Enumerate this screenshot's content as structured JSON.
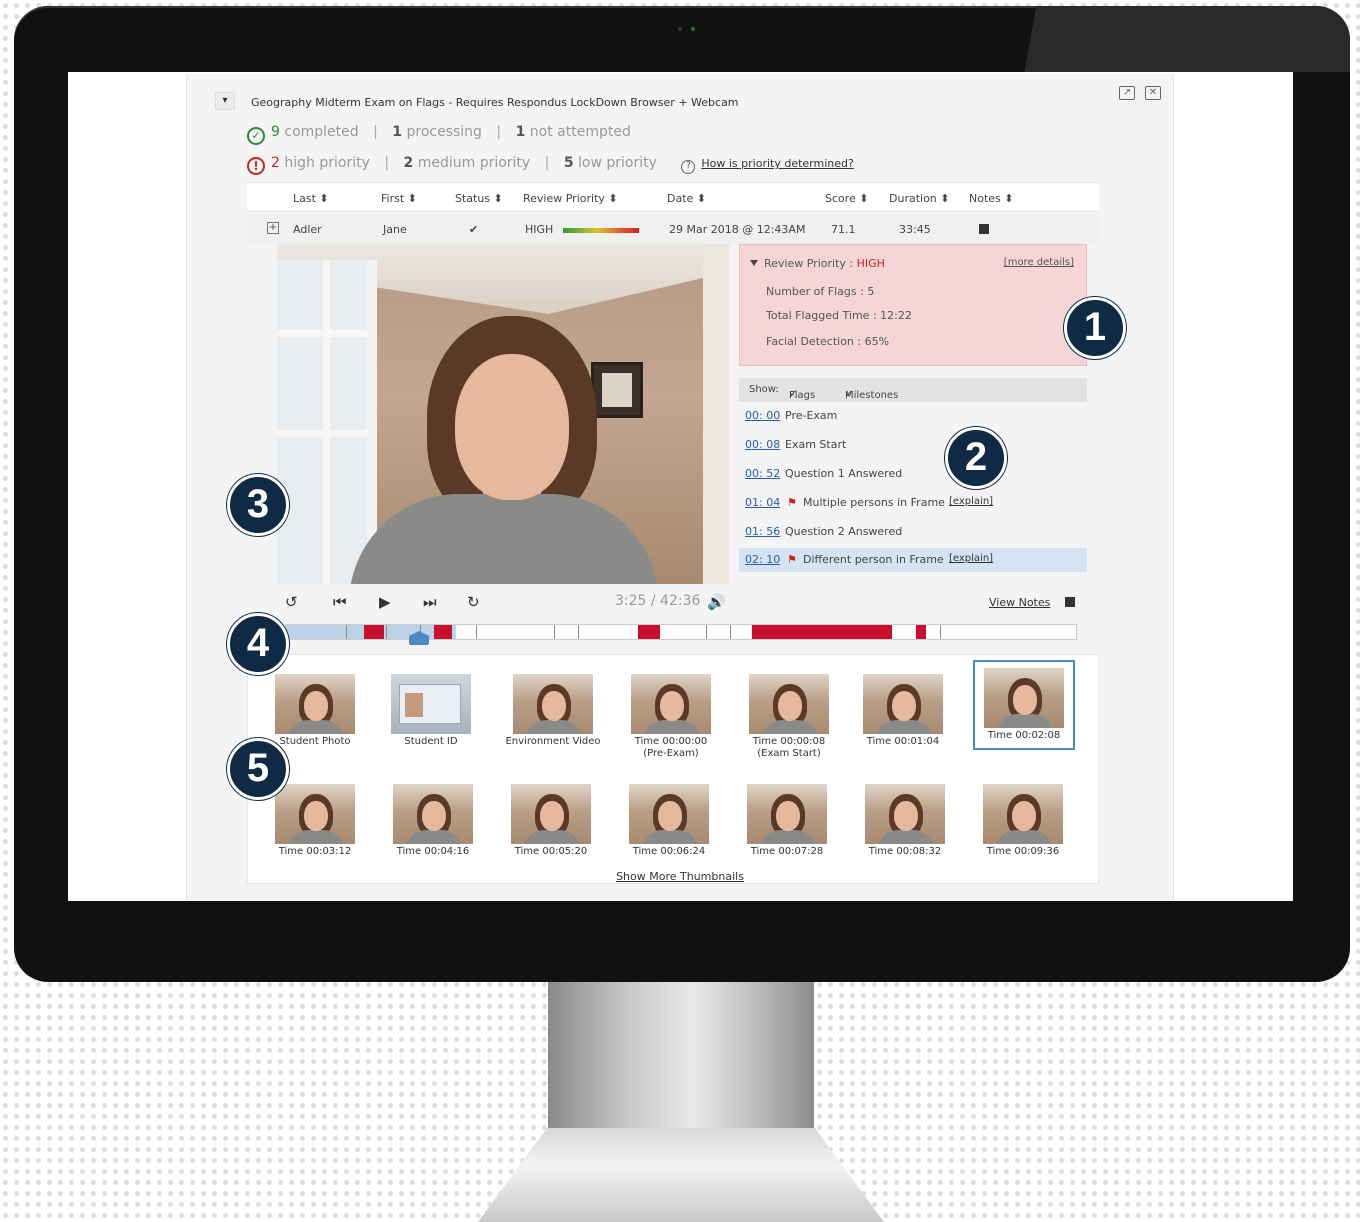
{
  "exam": {
    "title": "Geography Midterm Exam on Flags - Requires Respondus LockDown Browser + Webcam"
  },
  "summary": {
    "completed_count": "9",
    "completed_label": "completed",
    "processing_count": "1",
    "processing_label": "processing",
    "not_attempted_count": "1",
    "not_attempted_label": "not attempted",
    "high_count": "2",
    "high_label": "high priority",
    "medium_count": "2",
    "medium_label": "medium priority",
    "low_count": "5",
    "low_label": "low priority",
    "priority_help_link": "How is priority determined?"
  },
  "table": {
    "columns": [
      "Last ⬍",
      "First ⬍",
      "Status ⬍",
      "Review Priority ⬍",
      "Date ⬍",
      "Score ⬍",
      "Duration ⬍",
      "Notes ⬍"
    ],
    "row": {
      "last": "Adler",
      "first": "Jane",
      "status": "✔",
      "priority": "HIGH",
      "date": "29 Mar 2018 @ 12:43AM",
      "score": "71.1",
      "duration": "33:45"
    }
  },
  "review": {
    "heading": "Review Priority : ",
    "level": "HIGH",
    "more_details": "[more details]",
    "flags_line": "Number of Flags : 5",
    "flagged_time_line": "Total Flagged Time :  12:22",
    "facial_line": "Facial Detection : 65%"
  },
  "show_filter": {
    "label": "Show:",
    "flags": "Flags",
    "milestones": "Milestones"
  },
  "events": [
    {
      "time": "00: 00",
      "label": "Pre-Exam",
      "flag": false
    },
    {
      "time": "00: 08",
      "label": "Exam Start",
      "flag": false
    },
    {
      "time": "00: 52",
      "label": "Question 1 Answered",
      "flag": false
    },
    {
      "time": "01: 04",
      "label": "Multiple persons in Frame",
      "flag": true,
      "explain": "[explain]"
    },
    {
      "time": "01: 56",
      "label": "Question 2 Answered",
      "flag": false
    },
    {
      "time": "02: 10",
      "label": "Different person in Frame",
      "flag": true,
      "explain": "[explain]",
      "active": true
    }
  ],
  "player": {
    "current_time": "3:25 / 42:36",
    "view_notes": "View Notes",
    "progress_fraction": 0.082
  },
  "thumbnails_row1": [
    {
      "label": "Student Photo"
    },
    {
      "label": "Student ID"
    },
    {
      "label": "Environment Video"
    },
    {
      "label": "Time 00:00:00",
      "sub": "(Pre-Exam)"
    },
    {
      "label": "Time 00:00:08",
      "sub": "(Exam Start)"
    },
    {
      "label": "Time 00:01:04"
    },
    {
      "label": "Time 00:02:08"
    }
  ],
  "thumbnails_row2": [
    {
      "label": "Time 00:03:12"
    },
    {
      "label": "Time 00:04:16"
    },
    {
      "label": "Time 00:05:20"
    },
    {
      "label": "Time 00:06:24"
    },
    {
      "label": "Time 00:07:28"
    },
    {
      "label": "Time 00:08:32"
    },
    {
      "label": "Time 00:09:36"
    }
  ],
  "show_more": "Show More Thumbnails",
  "callouts": [
    "1",
    "2",
    "3",
    "4",
    "5"
  ],
  "colors": {
    "callout_bg": "#0f2a44",
    "flag_red": "#c62828",
    "milestone_blue": "#4f88c6"
  }
}
